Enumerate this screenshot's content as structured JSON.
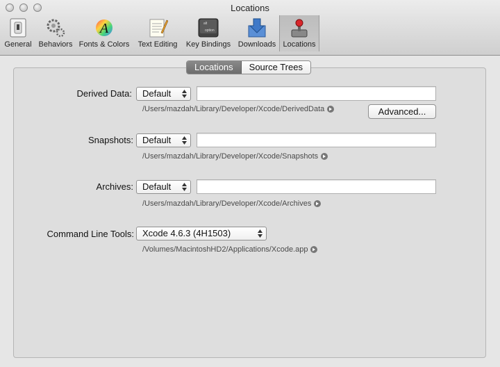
{
  "window": {
    "title": "Locations"
  },
  "toolbar": {
    "items": [
      {
        "label": "General",
        "icon": "switch-icon"
      },
      {
        "label": "Behaviors",
        "icon": "gears-icon"
      },
      {
        "label": "Fonts & Colors",
        "icon": "font-icon"
      },
      {
        "label": "Text Editing",
        "icon": "notepad-pencil-icon"
      },
      {
        "label": "Key Bindings",
        "icon": "keyboard-key-icon"
      },
      {
        "label": "Downloads",
        "icon": "download-box-icon"
      },
      {
        "label": "Locations",
        "icon": "joystick-icon"
      }
    ],
    "selected": "Locations"
  },
  "tabs": {
    "items": [
      "Locations",
      "Source Trees"
    ],
    "active": "Locations"
  },
  "settings": {
    "derived_data": {
      "label": "Derived Data:",
      "popup_value": "Default",
      "field_value": "",
      "path": "/Users/mazdah/Library/Developer/Xcode/DerivedData",
      "advanced_label": "Advanced..."
    },
    "snapshots": {
      "label": "Snapshots:",
      "popup_value": "Default",
      "field_value": "",
      "path": "/Users/mazdah/Library/Developer/Xcode/Snapshots"
    },
    "archives": {
      "label": "Archives:",
      "popup_value": "Default",
      "field_value": "",
      "path": "/Users/mazdah/Library/Developer/Xcode/Archives"
    },
    "command_line_tools": {
      "label": "Command Line Tools:",
      "popup_value": "Xcode 4.6.3 (4H1503)",
      "path": "/Volumes/MacintoshHD2/Applications/Xcode.app"
    }
  }
}
